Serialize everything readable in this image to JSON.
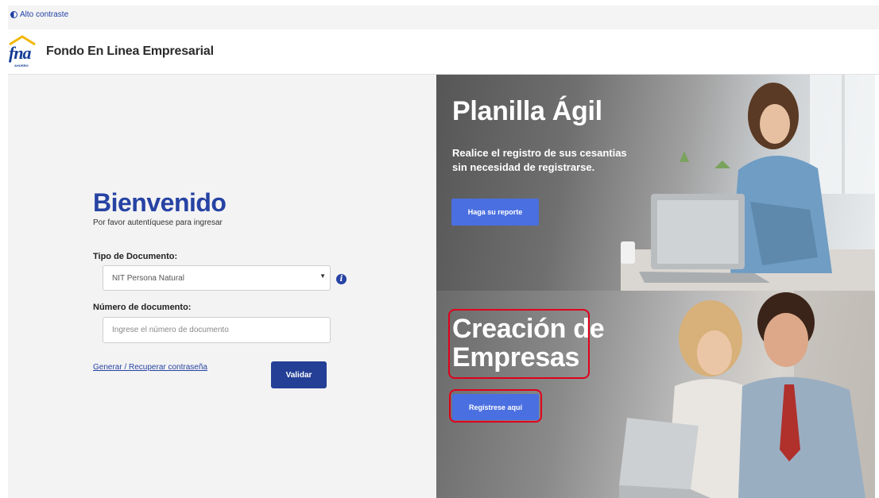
{
  "topbar": {
    "contrast_label": "Alto contraste"
  },
  "header": {
    "logo_text": "fna",
    "logo_subtext": "AHORRO",
    "title": "Fondo En Linea Empresarial"
  },
  "login": {
    "title": "Bienvenido",
    "subtitle": "Por favor autentíquese para ingresar",
    "doc_type_label": "Tipo de Documento:",
    "doc_type_value": "NIT Persona Natural",
    "doc_number_label": "Número de documento:",
    "doc_number_placeholder": "Ingrese el número de documento",
    "doc_number_value": "",
    "recover_link": "Generar / Recuperar contraseña",
    "submit_label": "Validar"
  },
  "promos": [
    {
      "title": "Planilla Ágil",
      "text_line1": "Realice el registro de sus cesantias",
      "text_line2": "sin necesidad de registrarse.",
      "button_label": "Haga su reporte"
    },
    {
      "title_line1": "Creación de",
      "title_line2": "Empresas",
      "button_label": "Regístrese aquí"
    }
  ],
  "colors": {
    "brand_blue": "#2643a4",
    "button_blue": "#233f96",
    "promo_button": "#4a6fe0",
    "highlight_red": "#e0001b"
  }
}
